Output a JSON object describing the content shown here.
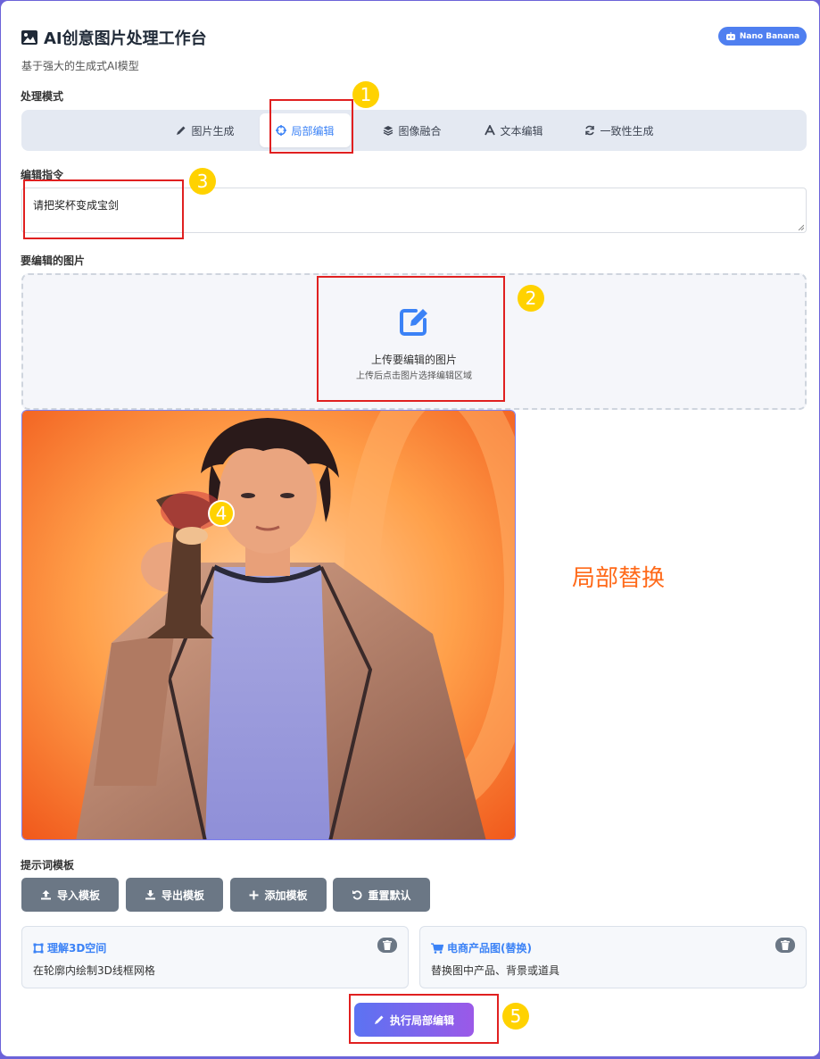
{
  "header": {
    "title": "AI创意图片处理工作台",
    "subtitle": "基于强大的生成式AI模型",
    "badge": "Nano Banana",
    "title_icon": "image-icon",
    "badge_icon": "robot-icon"
  },
  "mode": {
    "label": "处理模式",
    "tabs": [
      {
        "label": "图片生成",
        "icon": "pencil-icon"
      },
      {
        "label": "局部编辑",
        "icon": "crosshair-icon",
        "active": true
      },
      {
        "label": "图像融合",
        "icon": "layers-icon"
      },
      {
        "label": "文本编辑",
        "icon": "font-icon"
      },
      {
        "label": "一致性生成",
        "icon": "sync-icon"
      }
    ]
  },
  "instruction": {
    "label": "编辑指令",
    "value": "请把奖杯变成宝剑"
  },
  "upload": {
    "label": "要编辑的图片",
    "title": "上传要编辑的图片",
    "hint": "上传后点击图片选择编辑区域",
    "icon": "edit-icon"
  },
  "annotation": {
    "side_text": "局部替换",
    "markers": [
      "1",
      "2",
      "3",
      "4",
      "5"
    ]
  },
  "templates": {
    "label": "提示词模板",
    "buttons": [
      {
        "label": "导入模板",
        "icon": "upload-icon"
      },
      {
        "label": "导出模板",
        "icon": "download-icon"
      },
      {
        "label": "添加模板",
        "icon": "plus-icon"
      },
      {
        "label": "重置默认",
        "icon": "undo-icon"
      }
    ],
    "cards": [
      {
        "title": "理解3D空间",
        "desc": "在轮廓内绘制3D线框网格",
        "icon": "cube-icon"
      },
      {
        "title": "电商产品图(替换)",
        "desc": "替换图中产品、背景或道具",
        "icon": "cart-icon"
      }
    ]
  },
  "execute": {
    "label": "执行局部编辑",
    "icon": "pencil-icon"
  },
  "colors": {
    "accent": "#3b82f6",
    "annotation_red": "#e02020",
    "marker_yellow": "#ffd200",
    "side_text": "#ff6a1a"
  }
}
